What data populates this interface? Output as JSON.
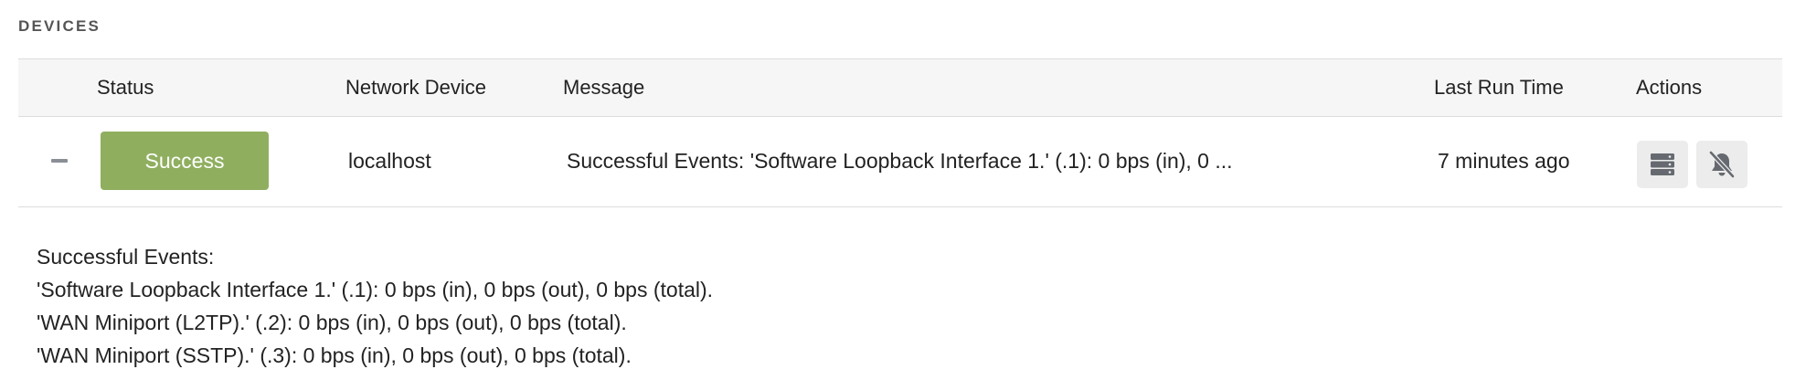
{
  "section": {
    "title": "DEVICES"
  },
  "table": {
    "headers": {
      "status": "Status",
      "device": "Network Device",
      "message": "Message",
      "last_run": "Last Run Time",
      "actions": "Actions"
    },
    "rows": [
      {
        "status": "Success",
        "status_color": "#8faf5f",
        "device": "localhost",
        "message": "Successful Events: 'Software Loopback Interface 1.' (.1): 0 bps (in), 0 ...",
        "last_run": "7 minutes ago",
        "actions": [
          {
            "icon": "server-icon"
          },
          {
            "icon": "bell-off-icon"
          }
        ],
        "details": [
          "Successful Events:",
          "'Software Loopback Interface 1.' (.1): 0 bps (in), 0 bps (out), 0 bps (total).",
          "'WAN Miniport (L2TP).' (.2): 0 bps (in), 0 bps (out), 0 bps (total).",
          "'WAN Miniport (SSTP).' (.3): 0 bps (in), 0 bps (out), 0 bps (total)."
        ]
      }
    ]
  }
}
